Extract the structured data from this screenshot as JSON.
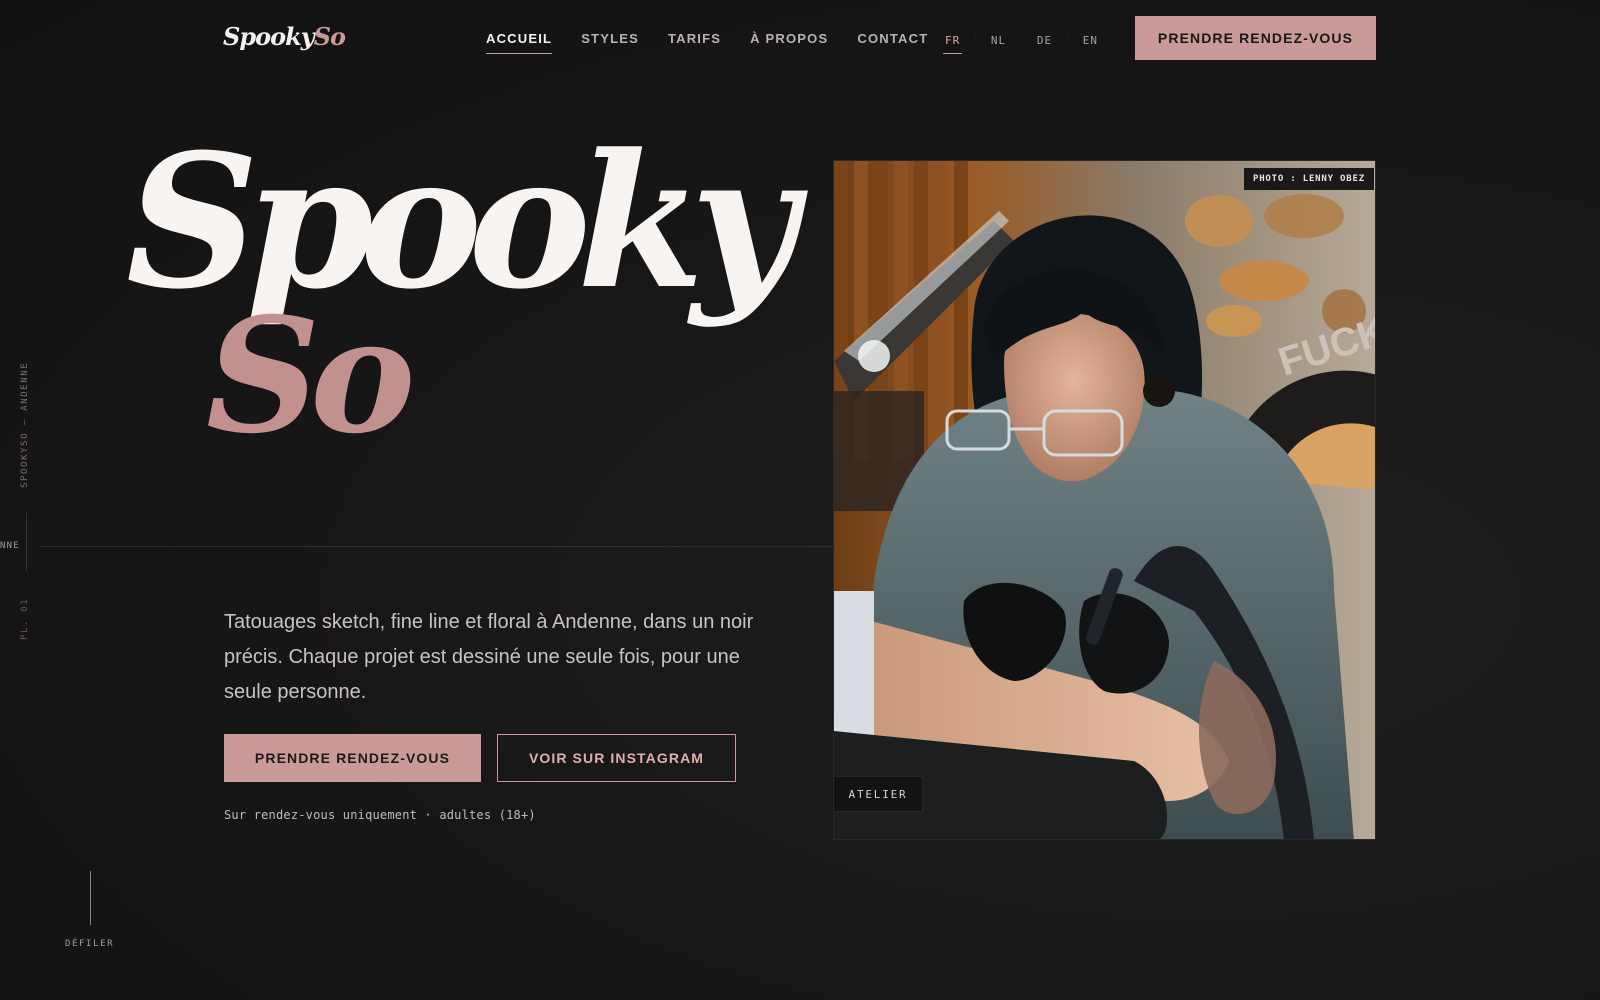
{
  "header": {
    "logo_main": "Spooky",
    "logo_accent": "So",
    "nav": [
      {
        "label": "ACCUEIL"
      },
      {
        "label": "STYLES"
      },
      {
        "label": "TARIFS"
      },
      {
        "label": "À PROPOS"
      },
      {
        "label": "CONTACT"
      }
    ],
    "languages": [
      "FR",
      "NL",
      "DE",
      "EN"
    ],
    "active_language": "FR",
    "cta": "PRENDRE RENDEZ-VOUS"
  },
  "side": {
    "vertical_text": "SPOOKYSO — ANDENNE",
    "plate": "PL. 01",
    "truncated_word": "NNE"
  },
  "hero": {
    "title_main": "Spooky",
    "title_accent": "So",
    "lead": "Tatouages sketch, fine line et floral à Andenne, dans un noir précis. Chaque projet est dessiné une seule fois, pour une seule personne.",
    "cta_primary": "PRENDRE RENDEZ-VOUS",
    "cta_secondary": "VOIR SUR INSTAGRAM",
    "note": "Sur rendez-vous uniquement · adultes (18+)",
    "scroll_label": "DÉFILER"
  },
  "photo": {
    "credit": "PHOTO : LENNY OBEZ",
    "label": "ATELIER",
    "wall_text": "FUCK"
  },
  "colors": {
    "background": "#171616",
    "accent": "#c99a97",
    "text": "#f4f1ee"
  }
}
